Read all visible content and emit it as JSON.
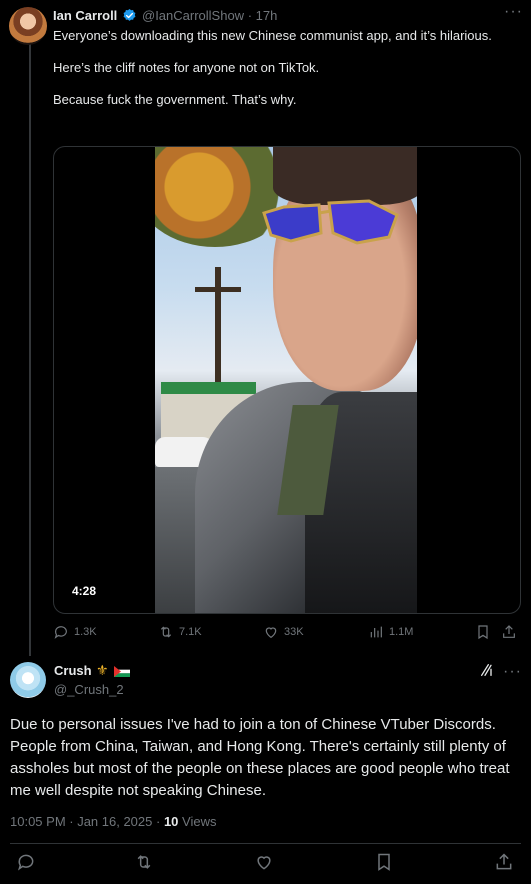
{
  "tweet": {
    "author_name": "Ian Carroll",
    "handle": "@IanCarrollShow",
    "time": "· 17h",
    "paragraphs": [
      "Everyone’s downloading this new Chinese communist app, and it’s hilarious.",
      "Here’s the cliff notes for anyone not on TikTok.",
      "Because fuck the government. That’s why."
    ],
    "video_duration": "4:28",
    "actions": {
      "replies": "1.3K",
      "reposts": "7.1K",
      "likes": "33K",
      "views": "1.1M"
    }
  },
  "reply": {
    "author_name": "Crush",
    "handle": "@_Crush_2",
    "emoji": "⚜",
    "text": "Due to personal issues I've had to join a ton of Chinese VTuber Discords. People from China, Taiwan, and Hong Kong. There's certainly still plenty of assholes but most of the people on these places are good people who treat me well despite not speaking Chinese.",
    "timestamp": "10:05 PM · Jan 16, 2025 · ",
    "views_count": "10",
    "views_label": " Views"
  },
  "icons": {
    "verified": "verified-badge-icon",
    "more": "more-icon",
    "reply": "reply-icon",
    "repost": "repost-icon",
    "like": "heart-icon",
    "views": "views-icon",
    "bookmark": "bookmark-icon",
    "share": "share-icon",
    "grok": "grok-icon"
  },
  "colors": {
    "background": "#000000",
    "text": "#e7e9ea",
    "muted": "#71767b",
    "verified": "#1d9bf0",
    "divider": "#2f3336"
  }
}
